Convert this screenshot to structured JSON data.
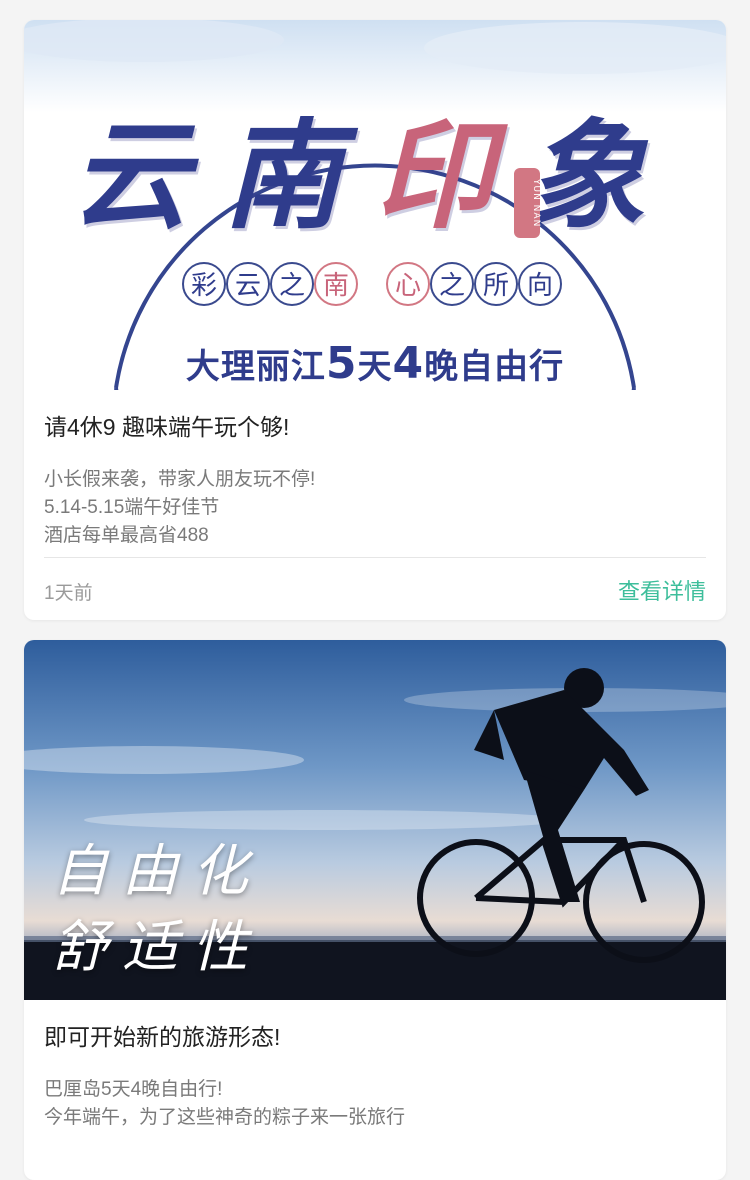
{
  "articles": [
    {
      "banner": {
        "headline_chars": [
          "云",
          "南",
          "印",
          "象"
        ],
        "seal_text": "YUN NAN",
        "chips": [
          "彩",
          "云",
          "之",
          "南",
          "心",
          "之",
          "所",
          "向"
        ],
        "subline_parts": [
          "大理丽江",
          "5",
          "天",
          "4",
          "晚自由行"
        ]
      },
      "title": "请4休9 趣味端午玩个够!",
      "description": [
        "小长假来袭，带家人朋友玩不停!",
        "5.14-5.15端午好佳节",
        "酒店每单最高省488"
      ],
      "time": "1天前",
      "action_label": "查看详情"
    },
    {
      "banner": {
        "lines": [
          "自由化",
          "舒适性"
        ]
      },
      "title": "即可开始新的旅游形态!",
      "description": [
        "巴厘岛5天4晚自由行!",
        "今年端午，为了这些神奇的粽子来一张旅行"
      ]
    }
  ],
  "colors": {
    "accent_green": "#3dbe9b",
    "banner_blue": "#2f3c8c",
    "banner_pink": "#c8647a"
  }
}
